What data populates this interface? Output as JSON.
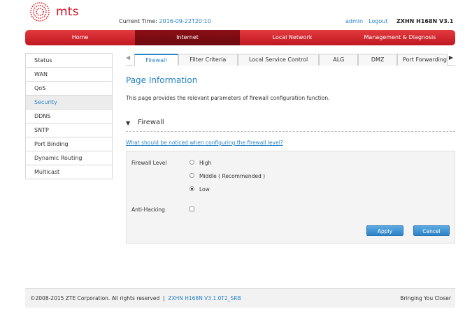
{
  "header": {
    "brand": "mts",
    "time_label": "Current Time:",
    "time_value": "2016-09-22T20:10",
    "user": "admin",
    "logout": "Logout",
    "model": "ZXHN H168N V3.1"
  },
  "main_nav": [
    {
      "label": "Home",
      "active": false
    },
    {
      "label": "Internet",
      "active": true
    },
    {
      "label": "Local Network",
      "active": false
    },
    {
      "label": "Management & Diagnosis",
      "active": false
    }
  ],
  "sidebar": [
    {
      "label": "Status",
      "active": false
    },
    {
      "label": "WAN",
      "active": false
    },
    {
      "label": "QoS",
      "active": false
    },
    {
      "label": "Security",
      "active": true
    },
    {
      "label": "DDNS",
      "active": false
    },
    {
      "label": "SNTP",
      "active": false
    },
    {
      "label": "Port Binding",
      "active": false
    },
    {
      "label": "Dynamic Routing",
      "active": false
    },
    {
      "label": "Multicast",
      "active": false
    }
  ],
  "sub_tabs": [
    {
      "label": "Firewall",
      "active": true
    },
    {
      "label": "Filter Criteria",
      "active": false
    },
    {
      "label": "Local Service Control",
      "active": false
    },
    {
      "label": "ALG",
      "active": false
    },
    {
      "label": "DMZ",
      "active": false
    },
    {
      "label": "Port Forwarding",
      "active": false
    }
  ],
  "content": {
    "page_title": "Page Information",
    "description": "This page provides the relevant parameters of firewall configuration function.",
    "section_title": "Firewall",
    "notice_link": "What should be noticed when configuring the firewall level?",
    "firewall_level_label": "Firewall Level",
    "levels": [
      {
        "label": "High",
        "selected": false
      },
      {
        "label": "Middle ( Recommended )",
        "selected": false
      },
      {
        "label": "Low",
        "selected": true
      }
    ],
    "anti_hacking_label": "Anti-Hacking",
    "anti_hacking_checked": false,
    "apply": "Apply",
    "cancel": "Cancel"
  },
  "footer": {
    "copyright": "©2008-2015 ZTE Corporation. All rights reserved",
    "separator": "|",
    "version": "ZXHN H168N V3.1.0T2_SRB",
    "slogan": "Bringing You Closer"
  },
  "colors": {
    "brand_red": "#d6121f",
    "accent_blue": "#2a83c6",
    "nav_active": "#7a0c12"
  }
}
